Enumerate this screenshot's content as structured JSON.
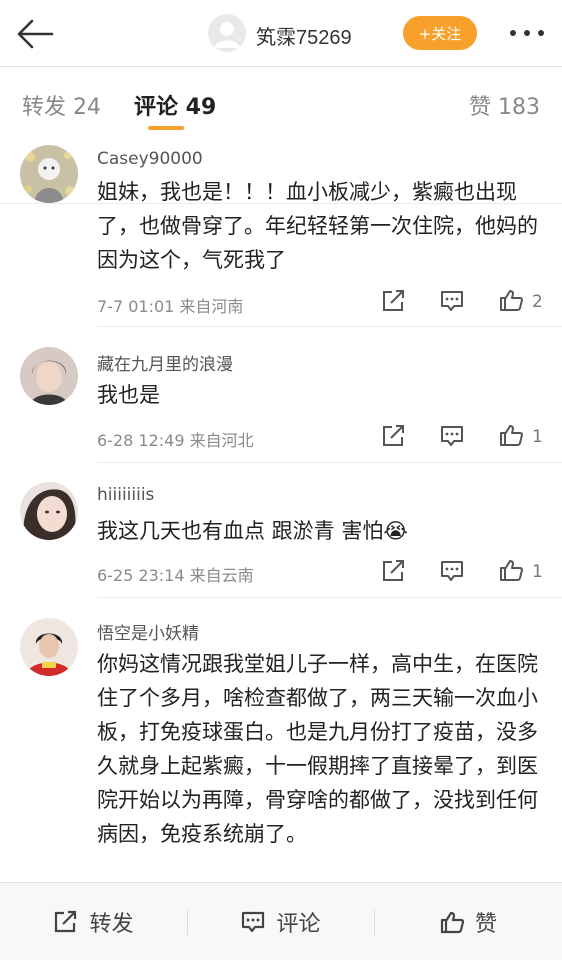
{
  "header": {
    "username": "笂霂75269",
    "follow_label": "+关注"
  },
  "tabs": {
    "repost": "转发 24",
    "comment": "评论 49",
    "like": "赞 183"
  },
  "comments": [
    {
      "name": "Casey90000",
      "text": "姐妹，我也是！！！血小板减少，紫癜也出现了，也做骨穿了。年纪轻轻第一次住院，他妈的因为这个，气死我了",
      "meta": "7-7 01:01  来自河南",
      "likes": "2"
    },
    {
      "name": "藏在九月里的浪漫",
      "text": "我也是",
      "meta": "6-28 12:49  来自河北",
      "likes": "1"
    },
    {
      "name": "hiiiiiiiis",
      "text": "我这几天也有血点 跟淤青 害怕😭",
      "meta": "6-25 23:14  来自云南",
      "likes": "1"
    },
    {
      "name": "悟空是小妖精",
      "text": "你妈这情况跟我堂姐儿子一样，高中生，在医院住了个多月，啥检查都做了，两三天输一次血小板，打免疫球蛋白。也是九月份打了疫苗，没多久就身上起紫癜，十一假期摔了直接晕了，到医院开始以为再障，骨穿啥的都做了，没找到任何病因，免疫系统崩了。"
    }
  ],
  "bottom_bar": {
    "repost": "转发",
    "comment": "评论",
    "like": "赞"
  },
  "colors": {
    "accent": "#f7a02b"
  }
}
